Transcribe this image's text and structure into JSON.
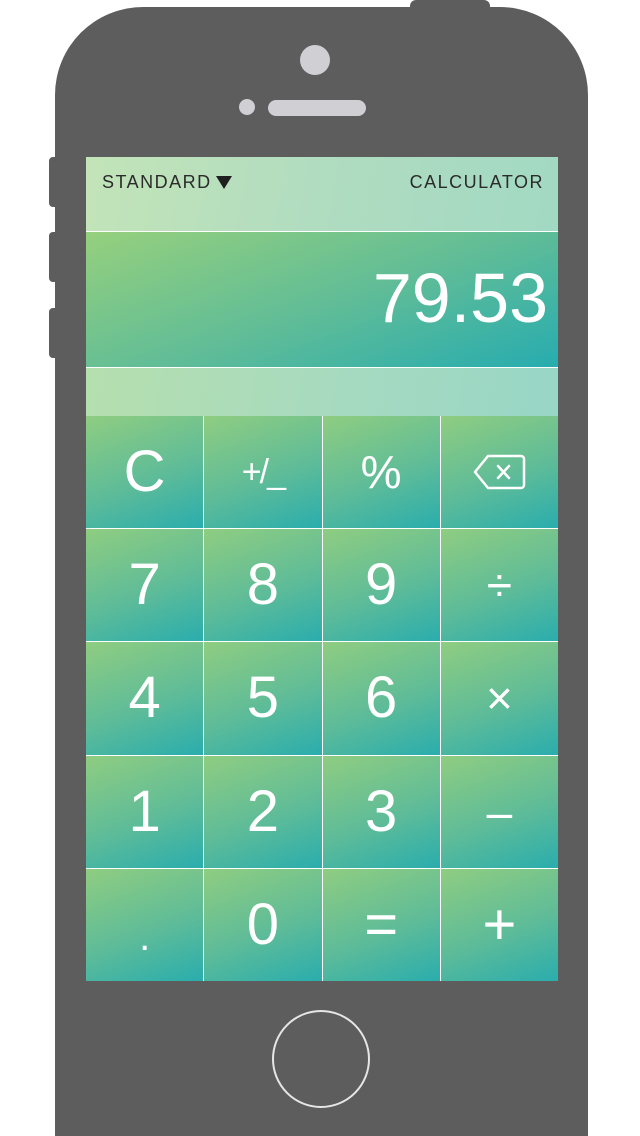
{
  "header": {
    "mode_label": "STANDARD",
    "title": "CALCULATOR"
  },
  "display": {
    "value": "79.53"
  },
  "keypad": {
    "rows": [
      [
        "C",
        "+/_",
        "%",
        "backspace-icon"
      ],
      [
        "7",
        "8",
        "9",
        "÷"
      ],
      [
        "4",
        "5",
        "6",
        "×"
      ],
      [
        "1",
        "2",
        "3",
        "–"
      ],
      [
        ".",
        "0",
        "=",
        "+"
      ]
    ],
    "clear": "C",
    "plus_minus": "+/_",
    "percent": "%",
    "backspace_icon": "backspace-icon",
    "seven": "7",
    "eight": "8",
    "nine": "9",
    "divide": "÷",
    "four": "4",
    "five": "5",
    "six": "6",
    "multiply": "×",
    "one": "1",
    "two": "2",
    "three": "3",
    "minus": "–",
    "decimal": ".",
    "zero": "0",
    "equals": "=",
    "plus": "+"
  },
  "colors": {
    "phone_body": "#5d5d5d",
    "gradient_start": "#96d07d",
    "gradient_end": "#27acaf",
    "text_on_keys": "#ffffff"
  }
}
